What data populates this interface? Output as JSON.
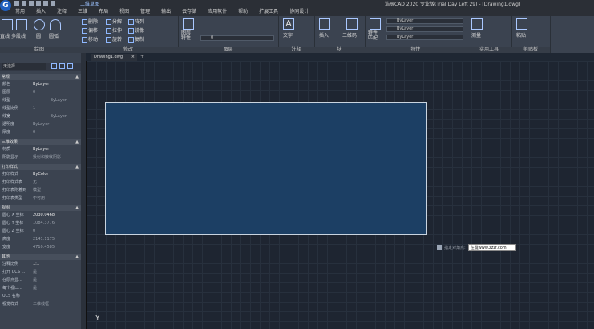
{
  "app": {
    "logo_letter": "G",
    "title": "浩辰CAD 2020 专业版(Trial Day Left 29) - [Drawing1.dwg]",
    "workspace": "二维草图"
  },
  "ribbon_tabs": [
    "常用",
    "插入",
    "注释",
    "三维",
    "布局",
    "视图",
    "管理",
    "输出",
    "云存储",
    "应用软件",
    "帮助",
    "扩展工具",
    "协同设计"
  ],
  "panels": {
    "draw": {
      "title": "绘图",
      "line": "直线",
      "polyline": "多段线",
      "circle": "圆",
      "arc": "圆弧"
    },
    "modify": {
      "title": "修改",
      "delete": "删除",
      "decompose": "分解",
      "array": "阵列",
      "offset": "偏移",
      "stretch": "拉伸",
      "mirror": "镜像",
      "move": "移动",
      "rotate": "旋转",
      "copy": "复制"
    },
    "layer": {
      "title": "图层",
      "props": "图层\n特性",
      "current": "0"
    },
    "annotation": {
      "title": "注释",
      "text": "文字"
    },
    "block": {
      "title": "块",
      "insert": "插入",
      "qr": "二维码"
    },
    "properties": {
      "title": "特性",
      "match": "特性\n匹配",
      "color": "ByLayer",
      "linetype": "ByLayer",
      "lineweight": "ByLayer"
    },
    "tools": {
      "title": "实用工具",
      "measure": "测量"
    },
    "clipboard": {
      "title": "剪贴板",
      "paste": "粘贴"
    }
  },
  "properties_panel": {
    "selection": "无选择",
    "sections": [
      {
        "title": "常规",
        "rows": [
          [
            "颜色",
            "ByLayer"
          ],
          [
            "图层",
            "0"
          ],
          [
            "线型",
            "———— ByLayer"
          ],
          [
            "线型比例",
            "1"
          ],
          [
            "线宽",
            "———— ByLayer"
          ],
          [
            "透明度",
            "ByLayer"
          ],
          [
            "厚度",
            "0"
          ]
        ]
      },
      {
        "title": "三维效果",
        "rows": [
          [
            "材质",
            "ByLayer"
          ],
          [
            "阴影显示",
            "投射和接收阴影"
          ]
        ]
      },
      {
        "title": "打印样式",
        "rows": [
          [
            "打印样式",
            "ByColor"
          ],
          [
            "打印样式表",
            "无"
          ],
          [
            "打印表附着到",
            "模型"
          ],
          [
            "打印表类型",
            "不可用"
          ]
        ]
      },
      {
        "title": "视图",
        "rows": [
          [
            "圆心 X 坐标",
            "2030.0468"
          ],
          [
            "圆心 Y 坐标",
            "1084.3776"
          ],
          [
            "圆心 Z 坐标",
            "0"
          ],
          [
            "高度",
            "2141.1175"
          ],
          [
            "宽度",
            "4710.4585"
          ]
        ]
      },
      {
        "title": "其他",
        "rows": [
          [
            "注释比例",
            "1:1"
          ],
          [
            "打开 UCS ...",
            "是"
          ],
          [
            "在原点显...",
            "是"
          ],
          [
            "每个视口...",
            "是"
          ],
          [
            "UCS 名称",
            ""
          ],
          [
            "视觉样式",
            "二维线框"
          ]
        ]
      }
    ]
  },
  "document_tab": "Drawing1.dwg",
  "command": {
    "prompt": "指定对角点:",
    "input_value": "在键www.zzzf.com"
  },
  "colors": {
    "rectangle_fill": "#1c3f64",
    "canvas_bg": "#1e2531",
    "ribbon_bg": "#3b4350"
  }
}
